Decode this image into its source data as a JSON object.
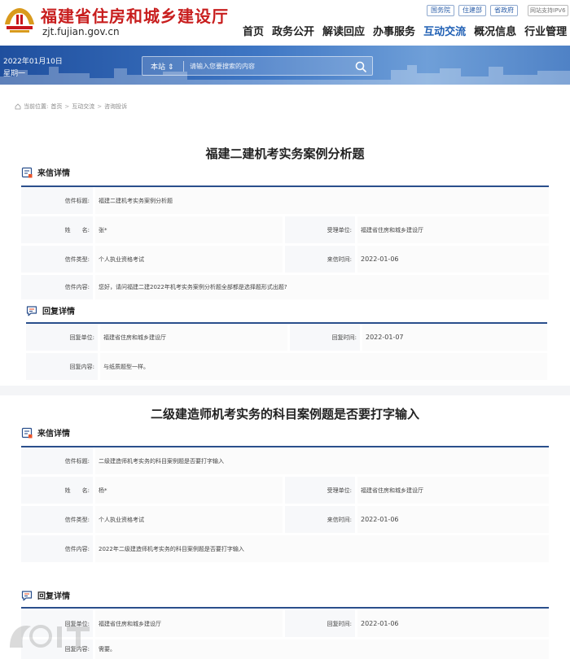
{
  "header": {
    "site_name": "福建省住房和城乡建设厅",
    "domain": "zjt.fujian.gov.cn",
    "gov_links": [
      "国务院",
      "住建部",
      "省政府"
    ],
    "pv_link": "网站支持IPV6",
    "nav": [
      "首页",
      "政务公开",
      "解读回应",
      "办事服务",
      "互动交流",
      "概况信息",
      "行业管理"
    ],
    "nav_active": "互动交流"
  },
  "banner": {
    "date": "2022年01月10日",
    "weekday": "星期一",
    "search_scope": "本站 ⇕",
    "search_placeholder": "请输入您要搜索的内容"
  },
  "breadcrumb": {
    "label": "当前位置:",
    "items": [
      "首页",
      "互动交流",
      "咨询投诉"
    ]
  },
  "letters": [
    {
      "title": "福建二建机考实务案例分析题",
      "letter_section": "来信详情",
      "subject_label": "信件标题:",
      "subject": "福建二建机考实务案例分析题",
      "name_label": "姓　　名:",
      "name": "张*",
      "dept_label": "受理单位:",
      "dept": "福建省住房和城乡建设厅",
      "type_label": "信件类型:",
      "type": "个人执业资格考试",
      "date_label": "来信时间:",
      "date": "2022-01-06",
      "content_label": "信件内容:",
      "content": "您好，请问福建二建2022年机考实务案例分析题全部都是选择题形式出题?",
      "reply_section": "回复详情",
      "reply_unit_label": "回复单位:",
      "reply_unit": "福建省住房和城乡建设厅",
      "reply_time_label": "回复时间:",
      "reply_time": "2022-01-07",
      "reply_content_label": "回复内容:",
      "reply_content": "与纸质题型一样。"
    },
    {
      "title": "二级建造师机考实务的科目案例题是否要打字输入",
      "letter_section": "来信详情",
      "subject_label": "信件标题:",
      "subject": "二级建造师机考实务的科目案例题是否要打字输入",
      "name_label": "姓　　名:",
      "name": "杨*",
      "dept_label": "受理单位:",
      "dept": "福建省住房和城乡建设厅",
      "type_label": "信件类型:",
      "type": "个人执业资格考试",
      "date_label": "来信时间:",
      "date": "2022-01-06",
      "content_label": "信件内容:",
      "content": "2022年二级建造师机考实务的科目案例题是否要打字输入",
      "reply_section": "回复详情",
      "reply_unit_label": "回复单位:",
      "reply_unit": "福建省住房和城乡建设厅",
      "reply_time_label": "回复时间:",
      "reply_time": "2022-01-06",
      "reply_content_label": "回复内容:",
      "reply_content": "需要。"
    }
  ],
  "colors": {
    "brand_red": "#c81e1e",
    "accent_blue": "#1f5fb4",
    "rule_blue": "#2a4f8c",
    "banner_blue": "#1f4f9e"
  }
}
